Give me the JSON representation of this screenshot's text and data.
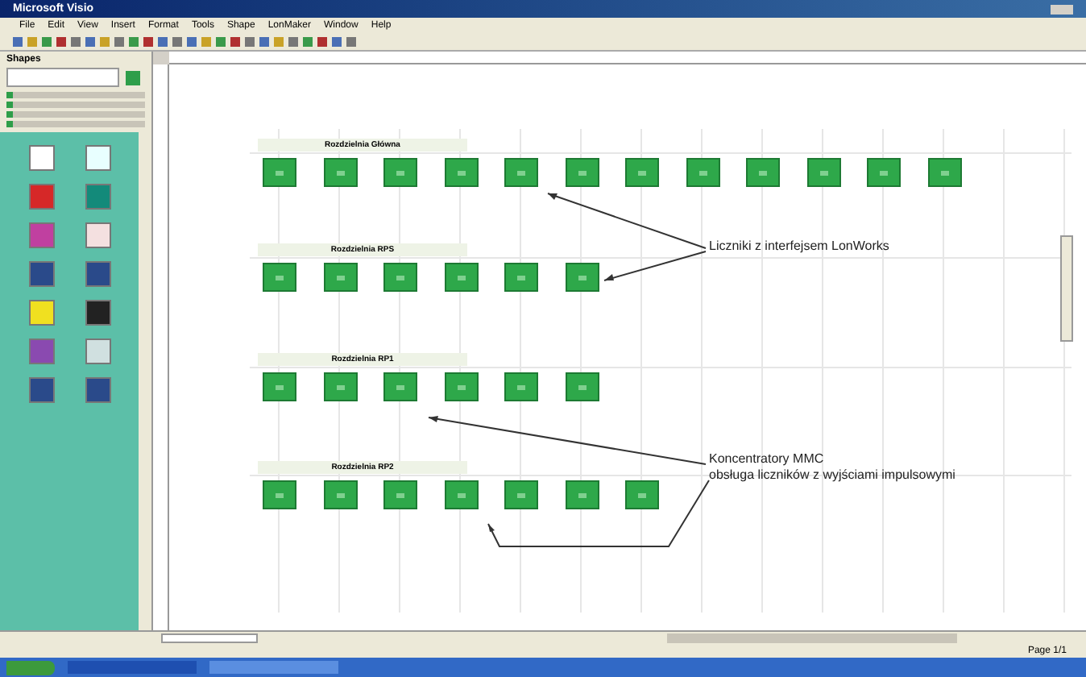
{
  "window": {
    "title": "Microsoft Visio"
  },
  "menu": [
    "File",
    "Edit",
    "View",
    "Insert",
    "Format",
    "Tools",
    "Shape",
    "LonMaker",
    "Window",
    "Help"
  ],
  "shapes_panel": {
    "title": "Shapes"
  },
  "diagram": {
    "sections": [
      {
        "title": "Rozdzielnia Główna",
        "devices": [
          {
            "kind": "meter"
          },
          {
            "kind": "meter"
          },
          {
            "kind": "meter"
          },
          {
            "kind": "meter"
          },
          {
            "kind": "meter"
          },
          {
            "kind": "meter"
          },
          {
            "kind": "meter"
          },
          {
            "kind": "meter"
          },
          {
            "kind": "meter"
          },
          {
            "kind": "meter"
          },
          {
            "kind": "meter"
          },
          {
            "kind": "meter"
          }
        ]
      },
      {
        "title": "Rozdzielnia RPS",
        "devices": [
          {
            "kind": "meter"
          },
          {
            "kind": "meter"
          },
          {
            "kind": "meter"
          },
          {
            "kind": "meter"
          },
          {
            "kind": "meter"
          },
          {
            "kind": "meter"
          }
        ]
      },
      {
        "title": "Rozdzielnia RP1",
        "devices": [
          {
            "kind": "meter"
          },
          {
            "kind": "meter"
          },
          {
            "kind": "meter"
          },
          {
            "kind": "meter"
          },
          {
            "kind": "meter"
          },
          {
            "kind": "meter"
          }
        ]
      },
      {
        "title": "Rozdzielnia RP2",
        "devices": [
          {
            "kind": "meter"
          },
          {
            "kind": "meter"
          },
          {
            "kind": "meter"
          },
          {
            "kind": "meter"
          },
          {
            "kind": "meter"
          },
          {
            "kind": "meter"
          },
          {
            "kind": "meter"
          }
        ]
      }
    ],
    "callouts": [
      {
        "lines": [
          "Liczniki z interfejsem LonWorks"
        ]
      },
      {
        "lines": [
          "Koncentratory MMC",
          "obsługa liczników z wyjściami impulsowymi"
        ]
      }
    ]
  },
  "status_bar": {
    "page": "Page 1/1"
  }
}
